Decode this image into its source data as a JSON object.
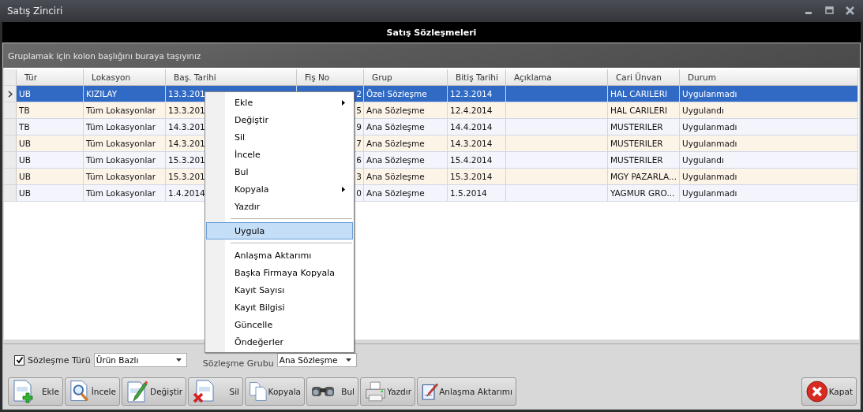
{
  "window": {
    "title": "Satış Zinciri"
  },
  "panel_title": "Satış Sözleşmeleri",
  "group_hint": "Gruplamak için kolon başlığını buraya taşıyınız",
  "table": {
    "columns": [
      "Tür",
      "Lokasyon",
      "Baş. Tarihi",
      "Fiş No",
      "Grup",
      "Bitiş Tarihi",
      "Açıklama",
      "Cari Ünvan",
      "Durum"
    ],
    "rows": [
      {
        "selected": true,
        "cells": [
          "UB",
          "KIZILAY",
          "13.3.201",
          "2",
          "Özel Sözleşme",
          "12.3.2014",
          "",
          "HAL CARILERI",
          "Uygulanmadı"
        ]
      },
      {
        "selected": false,
        "cells": [
          "TB",
          "Tüm Lokasyonlar",
          "13.3.201",
          "5",
          "Ana Sözleşme",
          "12.4.2014",
          "",
          "HAL CARILERI",
          "Uygulandı"
        ]
      },
      {
        "selected": false,
        "cells": [
          "TB",
          "Tüm Lokasyonlar",
          "14.3.201",
          "9",
          "Ana Sözleşme",
          "14.4.2014",
          "",
          "MUSTERILER",
          "Uygulanmadı"
        ]
      },
      {
        "selected": false,
        "cells": [
          "UB",
          "Tüm Lokasyonlar",
          "14.3.201",
          "7",
          "Ana Sözleşme",
          "14.3.2014",
          "",
          "MUSTERILER",
          "Uygulanmadı"
        ]
      },
      {
        "selected": false,
        "cells": [
          "UB",
          "Tüm Lokasyonlar",
          "15.3.201",
          "6",
          "Ana Sözleşme",
          "15.4.2014",
          "",
          "MUSTERILER",
          "Uygulandı"
        ]
      },
      {
        "selected": false,
        "cells": [
          "UB",
          "Tüm Lokasyonlar",
          "15.3.201",
          "3",
          "Ana Sözleşme",
          "15.3.2014",
          "",
          "MGY PAZARLA...",
          "Uygulanmadı"
        ]
      },
      {
        "selected": false,
        "cells": [
          "UB",
          "Tüm Lokasyonlar",
          "1.4.2014",
          "0",
          "Ana Sözleşme",
          "1.5.2014",
          "",
          "YAGMUR GRO...",
          "Uygulanmadı"
        ]
      }
    ]
  },
  "context_menu": [
    {
      "kind": "item",
      "label": "Ekle",
      "submenu": true,
      "selected": false
    },
    {
      "kind": "item",
      "label": "Değiştir",
      "submenu": false,
      "selected": false
    },
    {
      "kind": "item",
      "label": "Sil",
      "submenu": false,
      "selected": false
    },
    {
      "kind": "item",
      "label": "İncele",
      "submenu": false,
      "selected": false
    },
    {
      "kind": "item",
      "label": "Bul",
      "submenu": false,
      "selected": false
    },
    {
      "kind": "item",
      "label": "Kopyala",
      "submenu": true,
      "selected": false
    },
    {
      "kind": "item",
      "label": "Yazdır",
      "submenu": false,
      "selected": false
    },
    {
      "kind": "separator"
    },
    {
      "kind": "item",
      "label": "Uygula",
      "submenu": false,
      "selected": true
    },
    {
      "kind": "separator"
    },
    {
      "kind": "item",
      "label": "Anlaşma Aktarımı",
      "submenu": false,
      "selected": false
    },
    {
      "kind": "item",
      "label": "Başka Firmaya Kopyala",
      "submenu": false,
      "selected": false
    },
    {
      "kind": "item",
      "label": "Kayıt Sayısı",
      "submenu": false,
      "selected": false
    },
    {
      "kind": "item",
      "label": "Kayıt Bilgisi",
      "submenu": false,
      "selected": false
    },
    {
      "kind": "item",
      "label": "Güncelle",
      "submenu": false,
      "selected": false
    },
    {
      "kind": "item",
      "label": "Öndeğerler",
      "submenu": false,
      "selected": false
    }
  ],
  "filters": {
    "contract_type": {
      "label": "Sözleşme Türü",
      "checked": true,
      "value": "Ürün Bazlı"
    },
    "contract_group": {
      "label": "Sözleşme Grubu",
      "value": "Ana Sözleşme"
    }
  },
  "toolbar": [
    {
      "label": "Ekle"
    },
    {
      "label": "İncele"
    },
    {
      "label": "Değiştir"
    },
    {
      "label": "Sil"
    },
    {
      "label": "Kopyala"
    },
    {
      "label": "Bul"
    },
    {
      "label": "Yazdır"
    },
    {
      "label": "Anlaşma Aktarımı"
    }
  ],
  "close_button": {
    "label": "Kapat"
  }
}
